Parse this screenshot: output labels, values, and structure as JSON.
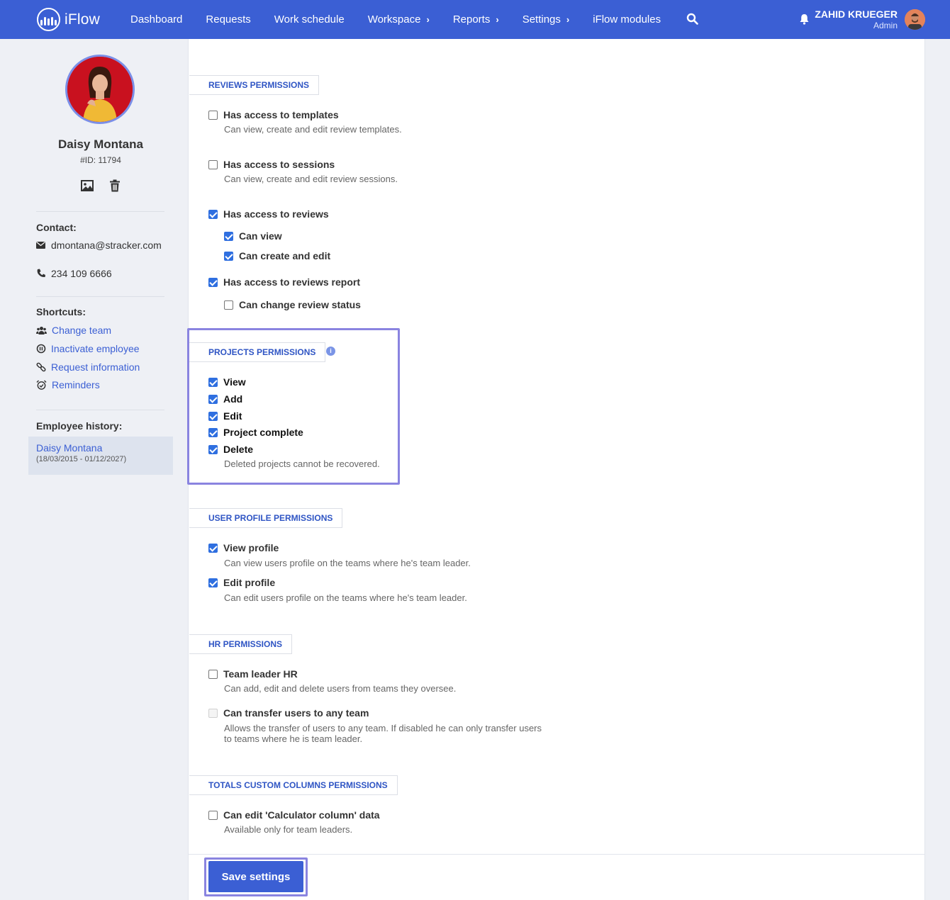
{
  "nav": {
    "logo_text": "iFlow",
    "items": [
      {
        "label": "Dashboard",
        "has_chevron": false
      },
      {
        "label": "Requests",
        "has_chevron": false
      },
      {
        "label": "Work schedule",
        "has_chevron": false
      },
      {
        "label": "Workspace",
        "has_chevron": true
      },
      {
        "label": "Reports",
        "has_chevron": true
      },
      {
        "label": "Settings",
        "has_chevron": true
      },
      {
        "label": "iFlow modules",
        "has_chevron": false
      }
    ],
    "chevron_glyph": "›",
    "user_name": "ZAHID KRUEGER",
    "user_role": "Admin",
    "bar_color": "#3b5fd4"
  },
  "profile": {
    "name": "Daisy Montana",
    "id": "#ID: 11794",
    "contact_label": "Contact:",
    "email": "dmontana@stracker.com",
    "phone": "234 109 6666",
    "shortcuts_label": "Shortcuts:",
    "shortcuts": [
      "Change team",
      "Inactivate employee",
      "Request information",
      "Reminders"
    ],
    "history_label": "Employee history:",
    "history_name": "Daisy Montana",
    "history_range": "(18/03/2015 - 01/12/2027)"
  },
  "sections": {
    "reviews": {
      "label": "REVIEWS PERMISSIONS",
      "items": [
        {
          "title": "Has access to templates",
          "desc": "Can view, create and edit review templates.",
          "checked": false
        },
        {
          "title": "Has access to sessions",
          "desc": "Can view, create and edit review sessions.",
          "checked": false
        },
        {
          "title": "Has access to reviews",
          "checked": true
        },
        {
          "title": "Can view",
          "checked": true
        },
        {
          "title": "Can create and edit",
          "checked": true
        },
        {
          "title": "Has access to reviews report",
          "checked": true
        },
        {
          "title": "Can change review status",
          "checked": false
        }
      ]
    },
    "projects": {
      "label": "PROJECTS PERMISSIONS",
      "items": [
        {
          "title": "View",
          "checked": true
        },
        {
          "title": "Add",
          "checked": true
        },
        {
          "title": "Edit",
          "checked": true
        },
        {
          "title": "Project complete",
          "checked": true
        },
        {
          "title": "Delete",
          "checked": true,
          "desc": "Deleted projects cannot be recovered."
        }
      ]
    },
    "user_profile": {
      "label": "USER PROFILE PERMISSIONS",
      "items": [
        {
          "title": "View profile",
          "desc": "Can view users profile on the teams where he's team leader.",
          "checked": true
        },
        {
          "title": "Edit profile",
          "desc": "Can edit users profile on the teams where he's team leader.",
          "checked": true
        }
      ]
    },
    "hr": {
      "label": "HR PERMISSIONS",
      "items": [
        {
          "title": "Team leader HR",
          "desc": "Can add, edit and delete users from teams they oversee.",
          "checked": false
        },
        {
          "title": "Can transfer users to any team",
          "desc": "Allows the transfer of users to any team. If disabled he can only transfer users to teams where he is team leader.",
          "checked": false,
          "disabled": true
        }
      ]
    },
    "totals": {
      "label": "TOTALS CUSTOM COLUMNS PERMISSIONS",
      "items": [
        {
          "title": "Can edit 'Calculator column' data",
          "desc": "Available only for team leaders.",
          "checked": false
        }
      ]
    }
  },
  "save_label": "Save settings",
  "accent_color": "#3b5fd4",
  "highlight_color": "#8a84e0"
}
